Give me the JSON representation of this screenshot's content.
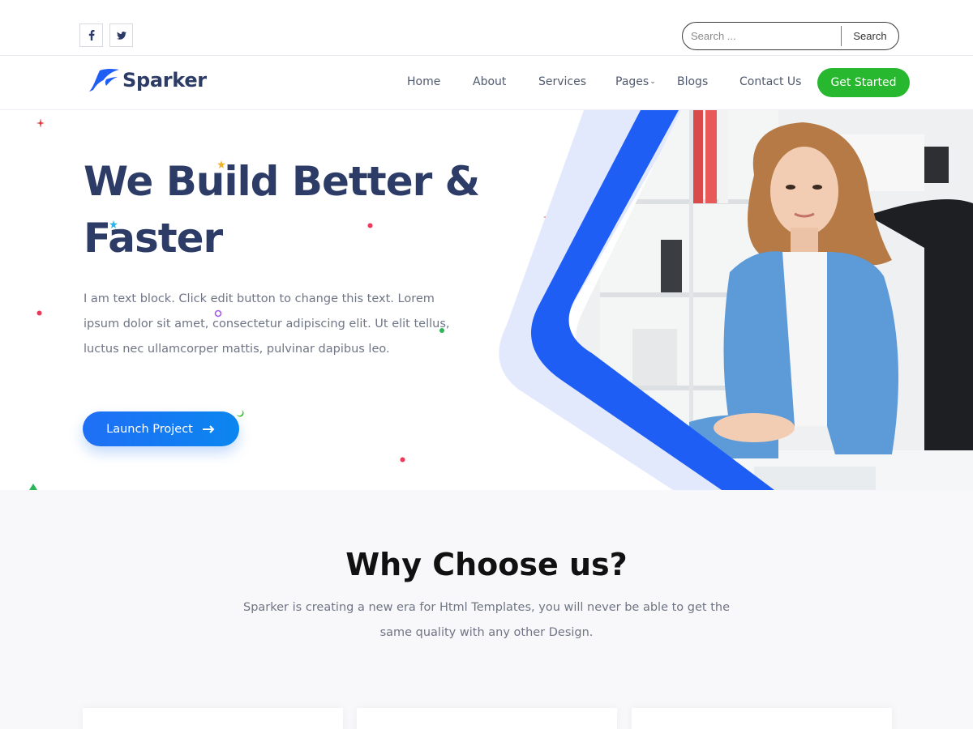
{
  "topbar": {
    "social": [
      {
        "icon": "facebook-icon",
        "glyph": "f"
      },
      {
        "icon": "twitter-icon",
        "glyph": "t"
      }
    ],
    "search": {
      "placeholder": "Search ...",
      "button_label": "Search"
    }
  },
  "navbar": {
    "logo_text": "Sparker",
    "items": [
      {
        "label": "Home"
      },
      {
        "label": "About"
      },
      {
        "label": "Services"
      },
      {
        "label": "Pages",
        "has_dropdown": true
      },
      {
        "label": "Blogs"
      },
      {
        "label": "Contact Us"
      }
    ],
    "cta_label": "Get Started"
  },
  "hero": {
    "title_line1": "We Build Better &",
    "title_line2": "Faster",
    "text": "I am text block. Click edit button to change this text. Lorem ipsum dolor sit amet, consectetur adipiscing elit. Ut elit tellus, luctus nec ullamcorper mattis, pulvinar dapibus leo.",
    "button_label": "Launch Project"
  },
  "why": {
    "title": "Why Choose us?",
    "text": "Sparker is creating a new era for Html Templates, you will never be able to get the same quality with any other Design."
  },
  "colors": {
    "brand_navy": "#2d3c66",
    "accent_blue": "#1f5ef5",
    "cta_green": "#28b82f",
    "light_blue": "#e3e9fd"
  }
}
